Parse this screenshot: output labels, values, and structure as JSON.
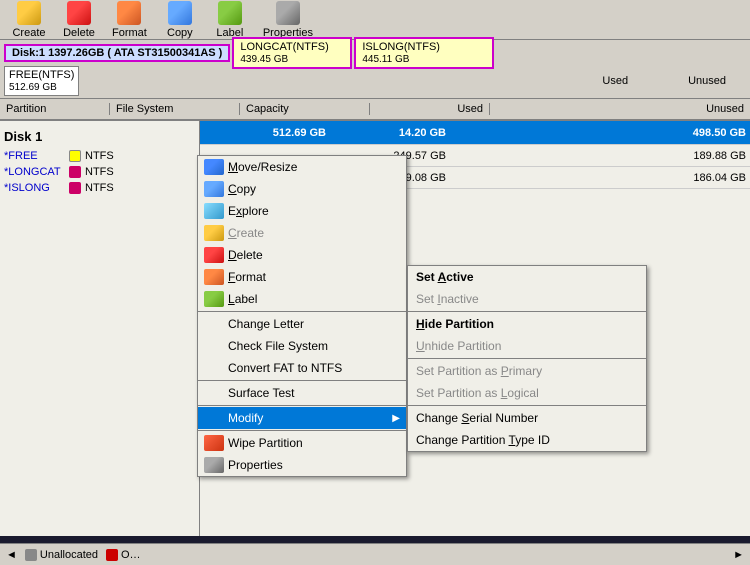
{
  "toolbar": {
    "items": [
      {
        "label": "Create",
        "icon": "create-icon"
      },
      {
        "label": "Delete",
        "icon": "delete-icon"
      },
      {
        "label": "Format",
        "icon": "format-icon"
      },
      {
        "label": "Copy",
        "icon": "copy-icon"
      },
      {
        "label": "Label",
        "icon": "label-icon"
      },
      {
        "label": "Properties",
        "icon": "properties-icon"
      }
    ]
  },
  "disk_map": {
    "disk_label": "Disk:1 1397.26GB ( ATA ST31500341AS )",
    "free_label": "FREE(NTFS)",
    "free_size": "512.69 GB",
    "longcat_label": "LONGCAT(NTFS)",
    "longcat_size": "439.45 GB",
    "islong_label": "ISLONG(NTFS)",
    "islong_size": "445.11 GB",
    "used_header": "Used",
    "unused_header": "Unused"
  },
  "col_headers": {
    "partition": "Partition",
    "filesystem": "File System",
    "capacity": "Capacity",
    "used": "Used",
    "unused": "Unused"
  },
  "disk1": {
    "heading": "Disk 1",
    "partitions": [
      {
        "name": "*FREE",
        "dot": "free",
        "filesystem": "NTFS",
        "capacity": "512.69 GB",
        "used": "14.20 GB",
        "unused": "498.50 GB"
      },
      {
        "name": "*LONGCAT",
        "dot": "ntfs",
        "filesystem": "NTFS",
        "capacity": "",
        "used": "249.57 GB",
        "unused": "189.88 GB"
      },
      {
        "name": "*ISLONG",
        "dot": "ntfs",
        "filesystem": "NTFS",
        "capacity": "",
        "used": "259.08 GB",
        "unused": "186.04 GB"
      }
    ]
  },
  "context_menu": {
    "items": [
      {
        "label": "Move/Resize",
        "icon": "move-icon",
        "disabled": false,
        "underline": "M"
      },
      {
        "label": "Copy",
        "icon": "copy-icon",
        "disabled": false,
        "underline": "C"
      },
      {
        "label": "Explore",
        "icon": "explore-icon",
        "disabled": false,
        "underline": "x"
      },
      {
        "label": "Create",
        "icon": "create-icon",
        "disabled": true,
        "underline": "C"
      },
      {
        "label": "Delete",
        "icon": "delete-icon",
        "disabled": false,
        "underline": "D"
      },
      {
        "label": "Format",
        "icon": "format-icon",
        "disabled": false,
        "underline": "F"
      },
      {
        "label": "Label",
        "icon": "label-icon",
        "disabled": false,
        "underline": "L"
      },
      {
        "divider": true
      },
      {
        "label": "Change Letter",
        "disabled": false,
        "underline": ""
      },
      {
        "label": "Check File System",
        "disabled": false,
        "underline": ""
      },
      {
        "label": "Convert FAT to NTFS",
        "disabled": false,
        "underline": ""
      },
      {
        "divider": true
      },
      {
        "label": "Surface Test",
        "disabled": false,
        "underline": ""
      },
      {
        "divider": true
      },
      {
        "label": "Modify",
        "disabled": false,
        "underline": "",
        "submenu": true,
        "highlighted": true
      },
      {
        "divider": true
      },
      {
        "label": "Wipe Partition",
        "icon": "wipe-icon",
        "disabled": false,
        "underline": ""
      },
      {
        "label": "Properties",
        "icon": "properties-icon",
        "disabled": false,
        "underline": ""
      }
    ]
  },
  "submenu": {
    "items": [
      {
        "label": "Set Active",
        "bold": true,
        "underline": "A"
      },
      {
        "label": "Set Inactive",
        "disabled": true,
        "underline": "I"
      },
      {
        "divider": true
      },
      {
        "label": "Hide Partition",
        "bold": true,
        "underline": "H"
      },
      {
        "label": "Unhide Partition",
        "disabled": true,
        "underline": "U"
      },
      {
        "divider": true
      },
      {
        "label": "Set Partition as Primary",
        "disabled": true,
        "underline": "P"
      },
      {
        "label": "Set Partition as Logical",
        "disabled": true,
        "underline": "L"
      },
      {
        "divider": true
      },
      {
        "label": "Change Serial Number",
        "bold": false,
        "underline": "S"
      },
      {
        "label": "Change Partition Type ID",
        "bold": false,
        "underline": "T"
      }
    ]
  },
  "status_bar": {
    "legend": [
      {
        "label": "Unallocated",
        "color": "#888888"
      },
      {
        "label": "O…",
        "color": "#cc0000"
      }
    ],
    "scroll_right": "►"
  }
}
